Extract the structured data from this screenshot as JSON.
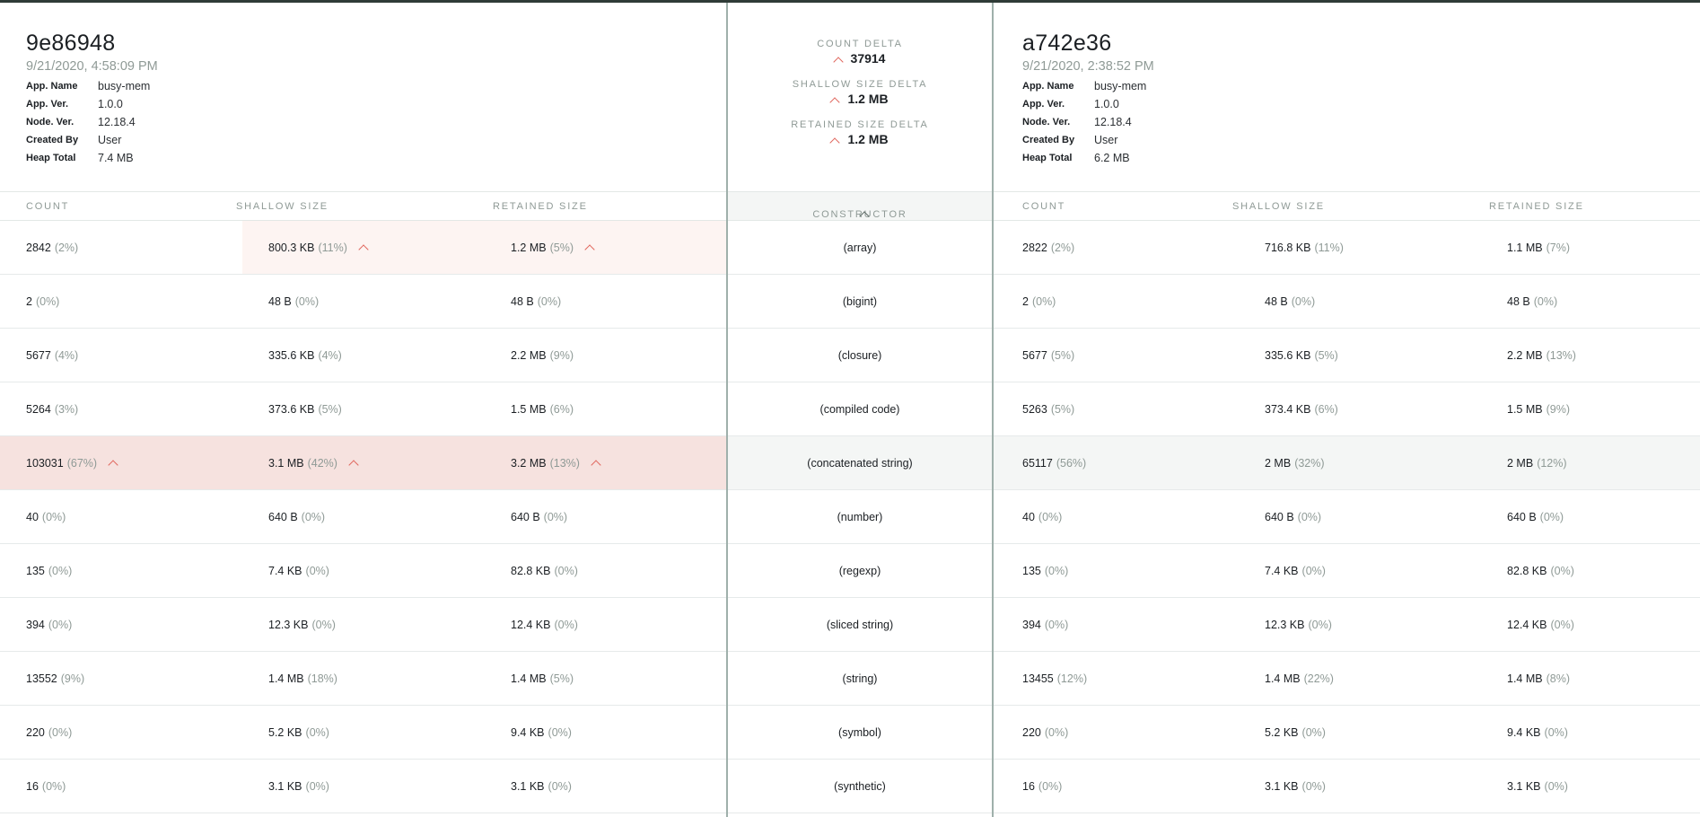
{
  "left": {
    "id": "9e86948",
    "date": "9/21/2020, 4:58:09 PM",
    "meta": [
      {
        "key": "App. Name",
        "value": "busy-mem"
      },
      {
        "key": "App. Ver.",
        "value": "1.0.0"
      },
      {
        "key": "Node. Ver.",
        "value": "12.18.4"
      },
      {
        "key": "Created By",
        "value": "User"
      },
      {
        "key": "Heap Total",
        "value": "7.4 MB"
      }
    ]
  },
  "right": {
    "id": "a742e36",
    "date": "9/21/2020, 2:38:52 PM",
    "meta": [
      {
        "key": "App. Name",
        "value": "busy-mem"
      },
      {
        "key": "App. Ver.",
        "value": "1.0.0"
      },
      {
        "key": "Node. Ver.",
        "value": "12.18.4"
      },
      {
        "key": "Created By",
        "value": "User"
      },
      {
        "key": "Heap Total",
        "value": "6.2 MB"
      }
    ]
  },
  "deltas": {
    "count_label": "COUNT DELTA",
    "count_value": "37914",
    "shallow_label": "SHALLOW SIZE DELTA",
    "shallow_value": "1.2 MB",
    "retained_label": "RETAINED SIZE DELTA",
    "retained_value": "1.2 MB"
  },
  "columns": {
    "count": "COUNT",
    "shallow": "SHALLOW SIZE",
    "retained": "RETAINED SIZE",
    "constructor": "CONSTRUCTOR"
  },
  "colors": {
    "increase_highlight": "#f6e2df",
    "increase_arrow": "#e0665d",
    "selected_row": "#f4f6f5",
    "divider": "#9fb0ab"
  },
  "rows": [
    {
      "constructor": "(array)",
      "left": {
        "count": "2842",
        "count_pct": "(2%)",
        "shallow": "800.3 KB",
        "shallow_pct": "(11%)",
        "retained": "1.2 MB",
        "retained_pct": "(5%)"
      },
      "right": {
        "count": "2822",
        "count_pct": "(2%)",
        "shallow": "716.8 KB",
        "shallow_pct": "(11%)",
        "retained": "1.1 MB",
        "retained_pct": "(7%)"
      }
    },
    {
      "constructor": "(bigint)",
      "left": {
        "count": "2",
        "count_pct": "(0%)",
        "shallow": "48 B",
        "shallow_pct": "(0%)",
        "retained": "48 B",
        "retained_pct": "(0%)"
      },
      "right": {
        "count": "2",
        "count_pct": "(0%)",
        "shallow": "48 B",
        "shallow_pct": "(0%)",
        "retained": "48 B",
        "retained_pct": "(0%)"
      }
    },
    {
      "constructor": "(closure)",
      "left": {
        "count": "5677",
        "count_pct": "(4%)",
        "shallow": "335.6 KB",
        "shallow_pct": "(4%)",
        "retained": "2.2 MB",
        "retained_pct": "(9%)"
      },
      "right": {
        "count": "5677",
        "count_pct": "(5%)",
        "shallow": "335.6 KB",
        "shallow_pct": "(5%)",
        "retained": "2.2 MB",
        "retained_pct": "(13%)"
      }
    },
    {
      "constructor": "(compiled code)",
      "left": {
        "count": "5264",
        "count_pct": "(3%)",
        "shallow": "373.6 KB",
        "shallow_pct": "(5%)",
        "retained": "1.5 MB",
        "retained_pct": "(6%)"
      },
      "right": {
        "count": "5263",
        "count_pct": "(5%)",
        "shallow": "373.4 KB",
        "shallow_pct": "(6%)",
        "retained": "1.5 MB",
        "retained_pct": "(9%)"
      }
    },
    {
      "constructor": "(concatenated string)",
      "left": {
        "count": "103031",
        "count_pct": "(67%)",
        "shallow": "3.1 MB",
        "shallow_pct": "(42%)",
        "retained": "3.2 MB",
        "retained_pct": "(13%)"
      },
      "right": {
        "count": "65117",
        "count_pct": "(56%)",
        "shallow": "2 MB",
        "shallow_pct": "(32%)",
        "retained": "2 MB",
        "retained_pct": "(12%)"
      }
    },
    {
      "constructor": "(number)",
      "left": {
        "count": "40",
        "count_pct": "(0%)",
        "shallow": "640 B",
        "shallow_pct": "(0%)",
        "retained": "640 B",
        "retained_pct": "(0%)"
      },
      "right": {
        "count": "40",
        "count_pct": "(0%)",
        "shallow": "640 B",
        "shallow_pct": "(0%)",
        "retained": "640 B",
        "retained_pct": "(0%)"
      }
    },
    {
      "constructor": "(regexp)",
      "left": {
        "count": "135",
        "count_pct": "(0%)",
        "shallow": "7.4 KB",
        "shallow_pct": "(0%)",
        "retained": "82.8 KB",
        "retained_pct": "(0%)"
      },
      "right": {
        "count": "135",
        "count_pct": "(0%)",
        "shallow": "7.4 KB",
        "shallow_pct": "(0%)",
        "retained": "82.8 KB",
        "retained_pct": "(0%)"
      }
    },
    {
      "constructor": "(sliced string)",
      "left": {
        "count": "394",
        "count_pct": "(0%)",
        "shallow": "12.3 KB",
        "shallow_pct": "(0%)",
        "retained": "12.4 KB",
        "retained_pct": "(0%)"
      },
      "right": {
        "count": "394",
        "count_pct": "(0%)",
        "shallow": "12.3 KB",
        "shallow_pct": "(0%)",
        "retained": "12.4 KB",
        "retained_pct": "(0%)"
      }
    },
    {
      "constructor": "(string)",
      "left": {
        "count": "13552",
        "count_pct": "(9%)",
        "shallow": "1.4 MB",
        "shallow_pct": "(18%)",
        "retained": "1.4 MB",
        "retained_pct": "(5%)"
      },
      "right": {
        "count": "13455",
        "count_pct": "(12%)",
        "shallow": "1.4 MB",
        "shallow_pct": "(22%)",
        "retained": "1.4 MB",
        "retained_pct": "(8%)"
      }
    },
    {
      "constructor": "(symbol)",
      "left": {
        "count": "220",
        "count_pct": "(0%)",
        "shallow": "5.2 KB",
        "shallow_pct": "(0%)",
        "retained": "9.4 KB",
        "retained_pct": "(0%)"
      },
      "right": {
        "count": "220",
        "count_pct": "(0%)",
        "shallow": "5.2 KB",
        "shallow_pct": "(0%)",
        "retained": "9.4 KB",
        "retained_pct": "(0%)"
      }
    },
    {
      "constructor": "(synthetic)",
      "left": {
        "count": "16",
        "count_pct": "(0%)",
        "shallow": "3.1 KB",
        "shallow_pct": "(0%)",
        "retained": "3.1 KB",
        "retained_pct": "(0%)"
      },
      "right": {
        "count": "16",
        "count_pct": "(0%)",
        "shallow": "3.1 KB",
        "shallow_pct": "(0%)",
        "retained": "3.1 KB",
        "retained_pct": "(0%)"
      }
    }
  ]
}
